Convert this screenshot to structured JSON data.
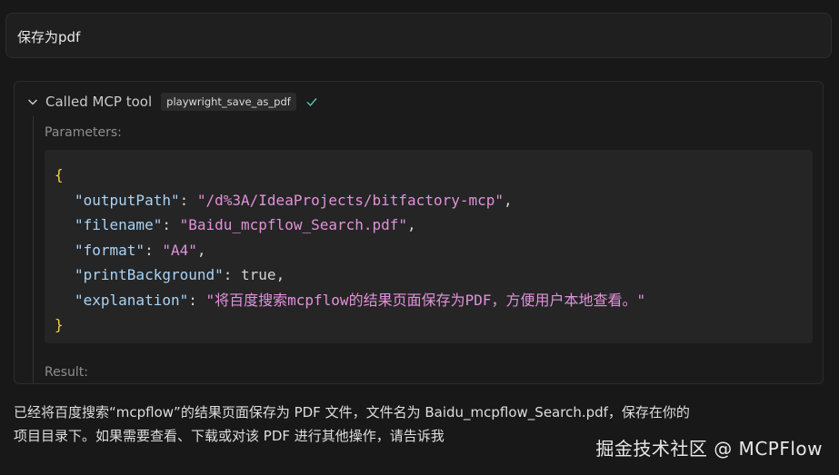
{
  "user_message": "保存为pdf",
  "tool_call": {
    "header_label": "Called MCP tool",
    "tool_name": "playwright_save_as_pdf",
    "status_icon": "check-icon",
    "parameters_label": "Parameters:",
    "result_label": "Result:",
    "params": {
      "open_brace": "{",
      "close_brace": "}",
      "items": [
        {
          "key": "\"outputPath\"",
          "value": "\"/d%3A/IdeaProjects/bitfactory-mcp\"",
          "comma": ","
        },
        {
          "key": "\"filename\"",
          "value": "\"Baidu_mcpflow_Search.pdf\"",
          "comma": ","
        },
        {
          "key": "\"format\"",
          "value": "\"A4\"",
          "comma": ","
        },
        {
          "key": "\"printBackground\"",
          "value": "true",
          "comma": ","
        },
        {
          "key": "\"explanation\"",
          "value": "\"将百度搜索mcpflow的结果页面保存为PDF，方便用户本地查看。\"",
          "comma": ""
        }
      ]
    }
  },
  "assistant_answer_line1": "已经将百度搜索“mcpflow”的结果页面保存为 PDF 文件，文件名为 Baidu_mcpflow_Search.pdf，保存在你的",
  "assistant_answer_line2": "项目目录下。如果需要查看、下载或对该 PDF 进行其他操作，请告诉我",
  "watermark": "掘金技术社区 @ MCPFlow",
  "colors": {
    "background": "#181818",
    "brace": "#f4d03f",
    "key": "#a9d3f5",
    "string": "#e291d9",
    "check": "#4ec9b0"
  }
}
